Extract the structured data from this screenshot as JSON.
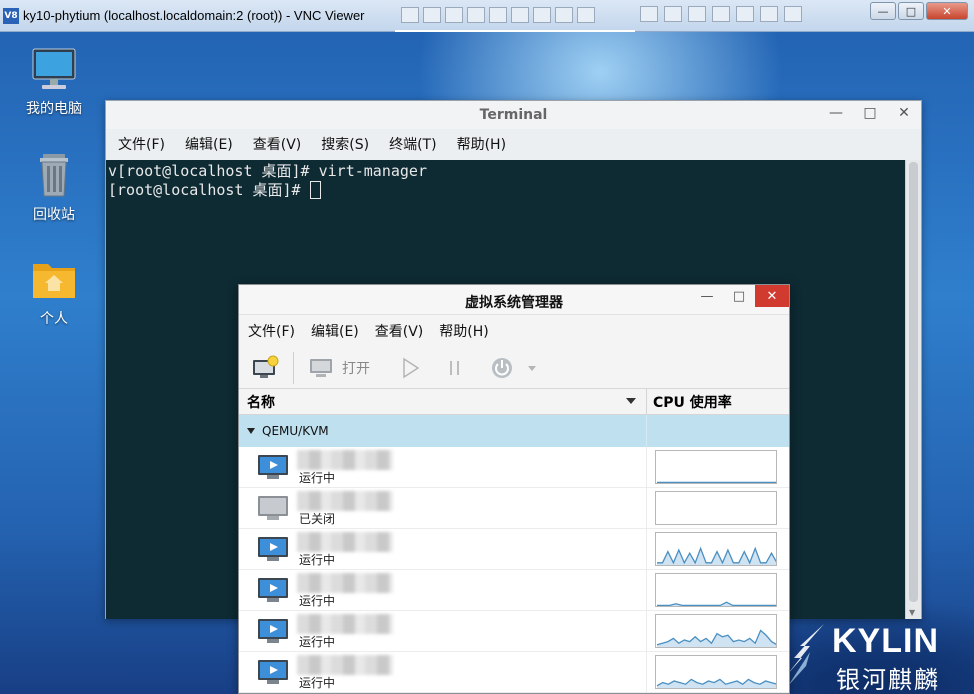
{
  "vnc": {
    "logo": "V8",
    "title": "ky10-phytium (localhost.localdomain:2 (root)) - VNC Viewer"
  },
  "desktop": {
    "icons": [
      {
        "label": "我的电脑",
        "icon": "computer-icon"
      },
      {
        "label": "回收站",
        "icon": "trash-icon"
      },
      {
        "label": "个人",
        "icon": "home-folder-icon"
      }
    ],
    "brand": {
      "name": "KYLIN",
      "subtitle": "银河麒麟"
    }
  },
  "terminal": {
    "title": "Terminal",
    "menu": [
      "文件(F)",
      "编辑(E)",
      "查看(V)",
      "搜索(S)",
      "终端(T)",
      "帮助(H)"
    ],
    "lines": [
      "v[root@localhost 桌面]# virt-manager",
      "[root@localhost 桌面]# "
    ]
  },
  "virt_manager": {
    "title": "虚拟系统管理器",
    "menu": [
      "文件(F)",
      "编辑(E)",
      "查看(V)",
      "帮助(H)"
    ],
    "toolbar": {
      "open_label": "打开"
    },
    "columns": {
      "name": "名称",
      "cpu": "CPU 使用率"
    },
    "group": "QEMU/KVM",
    "vms": [
      {
        "status": "运行中",
        "state": "running",
        "cpu": [
          0.05,
          0.05,
          0.05,
          0.05,
          0.05,
          0.05,
          0.05,
          0.05,
          0.05,
          0.05,
          0.05,
          0.05,
          0.05,
          0.05,
          0.05,
          0.05,
          0.05,
          0.05,
          0.05,
          0.05
        ]
      },
      {
        "status": "已关闭",
        "state": "off",
        "cpu": []
      },
      {
        "status": "运行中",
        "state": "running",
        "cpu": [
          0.1,
          0.1,
          0.45,
          0.1,
          0.5,
          0.1,
          0.4,
          0.1,
          0.55,
          0.1,
          0.1,
          0.45,
          0.1,
          0.5,
          0.1,
          0.1,
          0.45,
          0.1,
          0.55,
          0.1,
          0.1,
          0.4,
          0.1
        ]
      },
      {
        "status": "运行中",
        "state": "running",
        "cpu": [
          0.05,
          0.05,
          0.05,
          0.1,
          0.05,
          0.05,
          0.05,
          0.05,
          0.05,
          0.05,
          0.05,
          0.15,
          0.05,
          0.05,
          0.05,
          0.05,
          0.05,
          0.05,
          0.05,
          0.05
        ]
      },
      {
        "status": "运行中",
        "state": "running",
        "cpu": [
          0.1,
          0.15,
          0.2,
          0.3,
          0.15,
          0.25,
          0.2,
          0.35,
          0.2,
          0.3,
          0.15,
          0.45,
          0.35,
          0.4,
          0.2,
          0.25,
          0.2,
          0.3,
          0.15,
          0.55,
          0.4,
          0.2,
          0.1
        ]
      },
      {
        "status": "运行中",
        "state": "running",
        "cpu": [
          0.1,
          0.2,
          0.15,
          0.25,
          0.2,
          0.15,
          0.3,
          0.2,
          0.15,
          0.25,
          0.2,
          0.3,
          0.15,
          0.2,
          0.25,
          0.15,
          0.3,
          0.2,
          0.15,
          0.25,
          0.2,
          0.15
        ]
      }
    ]
  }
}
